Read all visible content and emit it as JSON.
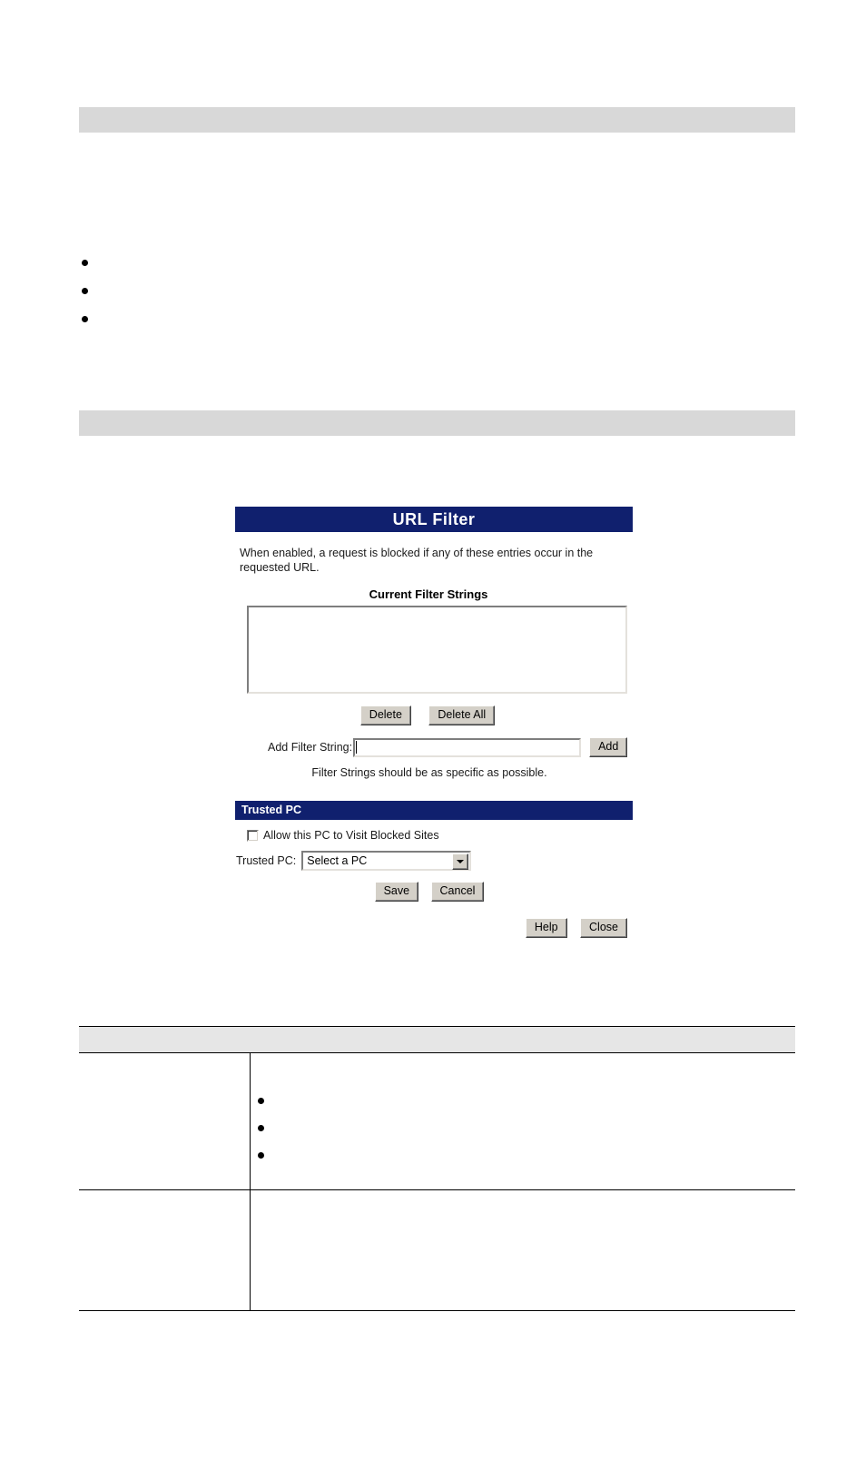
{
  "document": {
    "section_bars": [
      {
        "label": ""
      },
      {
        "label": ""
      }
    ],
    "top_bullets": [
      {
        "text": ""
      },
      {
        "text": ""
      },
      {
        "text": ""
      }
    ]
  },
  "url_filter_screen": {
    "title": "URL Filter",
    "intro": "When enabled, a request is blocked if any of these entries occur in the requested URL.",
    "filter_strings_label": "Current Filter Strings",
    "filter_strings_items": [],
    "delete_label": "Delete",
    "delete_all_label": "Delete All",
    "add_filter_label": "Add Filter String:",
    "add_filter_value": "",
    "add_filter_placeholder": "",
    "add_label": "Add",
    "note": "Filter Strings should be as specific as possible.",
    "trusted_pc": {
      "section_title": "Trusted PC",
      "allow_checkbox_label": "Allow this PC to Visit Blocked Sites",
      "allow_checkbox_checked": false,
      "trusted_pc_label": "Trusted PC:",
      "trusted_pc_selected": "Select a PC",
      "trusted_pc_options": [
        "Select a PC"
      ]
    },
    "save_label": "Save",
    "cancel_label": "Cancel",
    "help_label": "Help",
    "close_label": "Close"
  },
  "reference_table": {
    "header": {
      "name": "",
      "description": ""
    },
    "rows": [
      {
        "name": "",
        "description": "",
        "bullets": [
          {
            "text": ""
          },
          {
            "text": ""
          },
          {
            "text": ""
          }
        ]
      },
      {
        "name": "",
        "description": "",
        "bullets": []
      }
    ]
  },
  "colors": {
    "panel_header_blue": "#10206e",
    "section_bar_gray": "#d8d8d8",
    "table_header_gray": "#e6e6e6",
    "button_face": "#d4d0c8",
    "page_background": "#ffffff"
  }
}
